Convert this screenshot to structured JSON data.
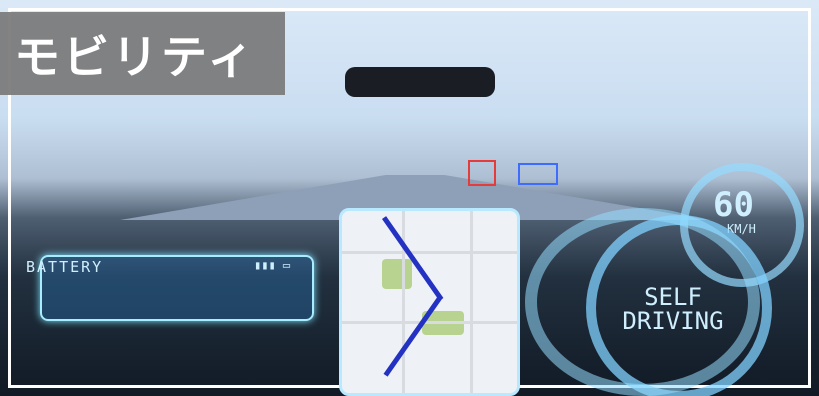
{
  "title": "モビリティ",
  "hud": {
    "battery_label": "BATTERY",
    "speed_value": "60",
    "speed_unit": "KM/H",
    "self_driving_line1": "SELF",
    "self_driving_line2": "DRIVING"
  },
  "colors": {
    "title_background": "#7b7b7b",
    "hud_cyan": "#a7ecff",
    "route_blue": "#2332c2"
  }
}
